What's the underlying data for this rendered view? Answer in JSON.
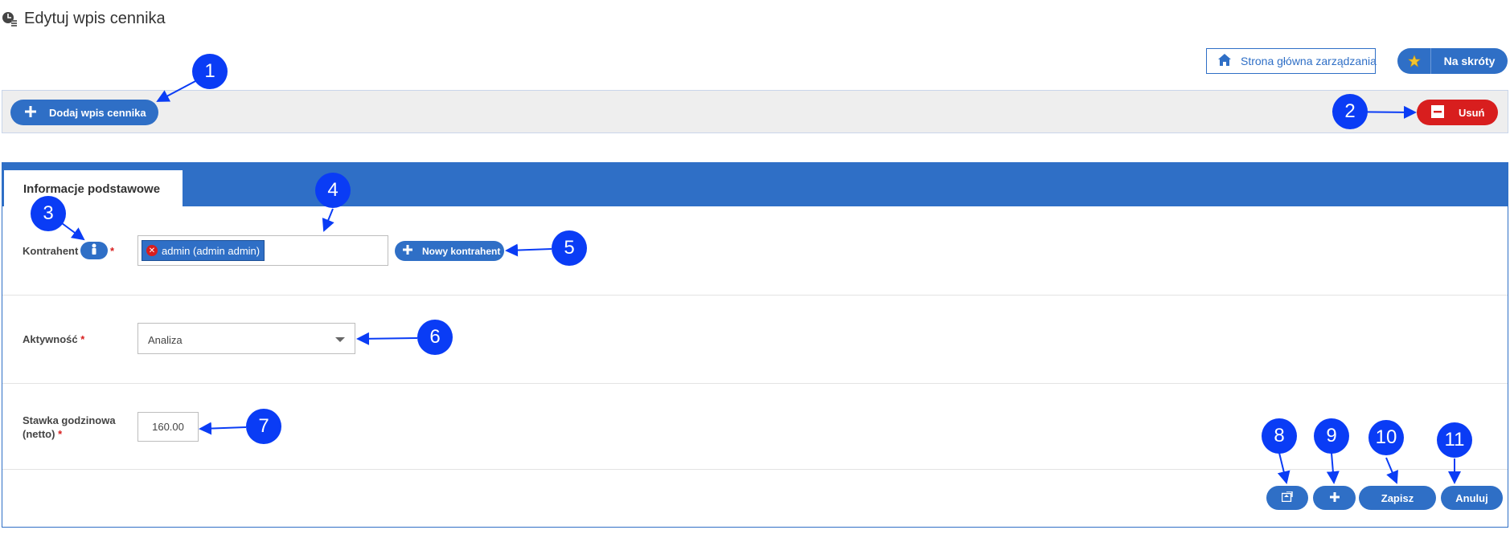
{
  "header": {
    "title": "Edytuj wpis cennika",
    "home_label": "Strona główna zarządzania",
    "shortcuts_label": "Na skróty"
  },
  "toolbar": {
    "add_label": "Dodaj wpis cennika",
    "delete_label": "Usuń"
  },
  "tabs": [
    {
      "label": "Informacje podstawowe",
      "active": true
    }
  ],
  "form": {
    "contractor": {
      "label": "Kontrahent",
      "required_mark": "*",
      "selected": "admin (admin admin)",
      "new_button_label": "Nowy kontrahent"
    },
    "activity": {
      "label": "Aktywność",
      "required_mark": "*",
      "value": "Analiza"
    },
    "hourly_rate": {
      "label_line1": "Stawka godzinowa",
      "label_line2": "(netto)",
      "required_mark": "*",
      "value": "160.00"
    }
  },
  "actions": {
    "save_label": "Zapisz",
    "cancel_label": "Anuluj"
  },
  "callouts": [
    "1",
    "2",
    "3",
    "4",
    "5",
    "6",
    "7",
    "8",
    "9",
    "10",
    "11"
  ],
  "colors": {
    "primary": "#2f6fc6",
    "danger": "#d81e1e",
    "callout": "#0a3cf5",
    "toolbar_bg": "#eeeeee"
  }
}
